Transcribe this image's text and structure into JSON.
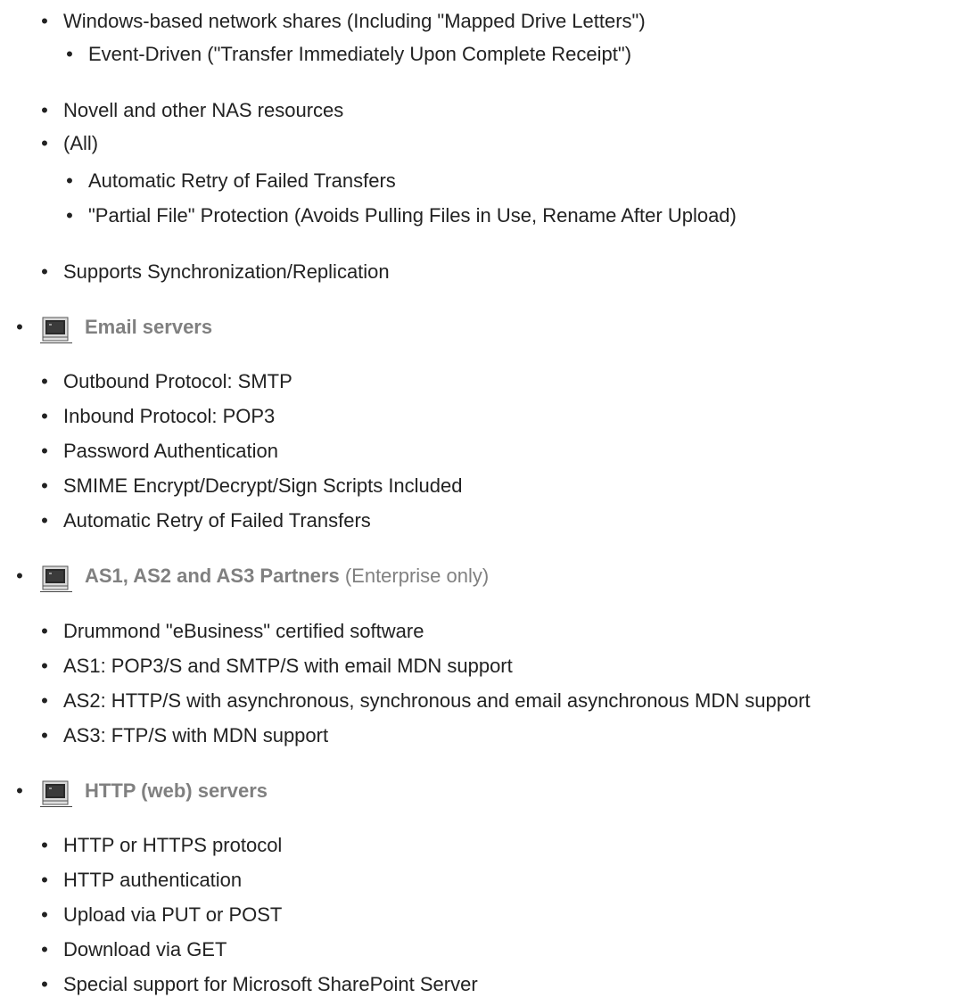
{
  "intro_items": [
    "Windows-based network shares (Including \"Mapped Drive Letters\")",
    "Event-Driven (\"Transfer Immediately Upon Complete Receipt\")",
    "Novell and other NAS resources",
    "(All)",
    "Automatic Retry of Failed Transfers",
    "\"Partial File\" Protection (Avoids Pulling Files in Use, Rename After Upload)",
    "Supports Synchronization/Replication"
  ],
  "sections": [
    {
      "title": "Email servers",
      "note": "",
      "icon": "computer-icon",
      "items": [
        "Outbound Protocol: SMTP",
        "Inbound Protocol: POP3",
        "Password Authentication",
        "SMIME Encrypt/Decrypt/Sign Scripts Included",
        "Automatic Retry of Failed Transfers"
      ]
    },
    {
      "title": "AS1, AS2 and AS3 Partners",
      "note": "(Enterprise only)",
      "icon": "computer-icon",
      "items": [
        "Drummond \"eBusiness\" certified software",
        "AS1: POP3/S and SMTP/S with email MDN support",
        "AS2: HTTP/S with asynchronous, synchronous and email asynchronous MDN support",
        "AS3: FTP/S with MDN support"
      ]
    },
    {
      "title": "HTTP (web) servers",
      "note": "",
      "icon": "computer-icon",
      "items": [
        "HTTP or HTTPS protocol",
        "HTTP authentication",
        "Upload via PUT or POST",
        "Download via GET",
        "Special support for Microsoft SharePoint Server"
      ]
    }
  ],
  "bullet_glyph": "•"
}
